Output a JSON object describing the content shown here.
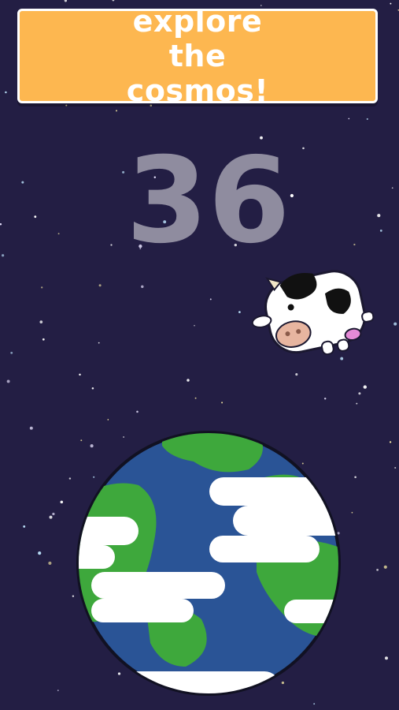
{
  "banner": {
    "label": "explore the cosmos!"
  },
  "hud": {
    "score": "36"
  },
  "icons": {
    "player": "cow-icon",
    "planet": "earth-icon"
  },
  "colors": {
    "background": "#231e44",
    "banner": "#fdb750",
    "banner_text": "#ffffff",
    "score": "#8f8c9f",
    "ocean": "#2a5496",
    "land": "#3ea83c",
    "cloud": "#ffffff"
  }
}
